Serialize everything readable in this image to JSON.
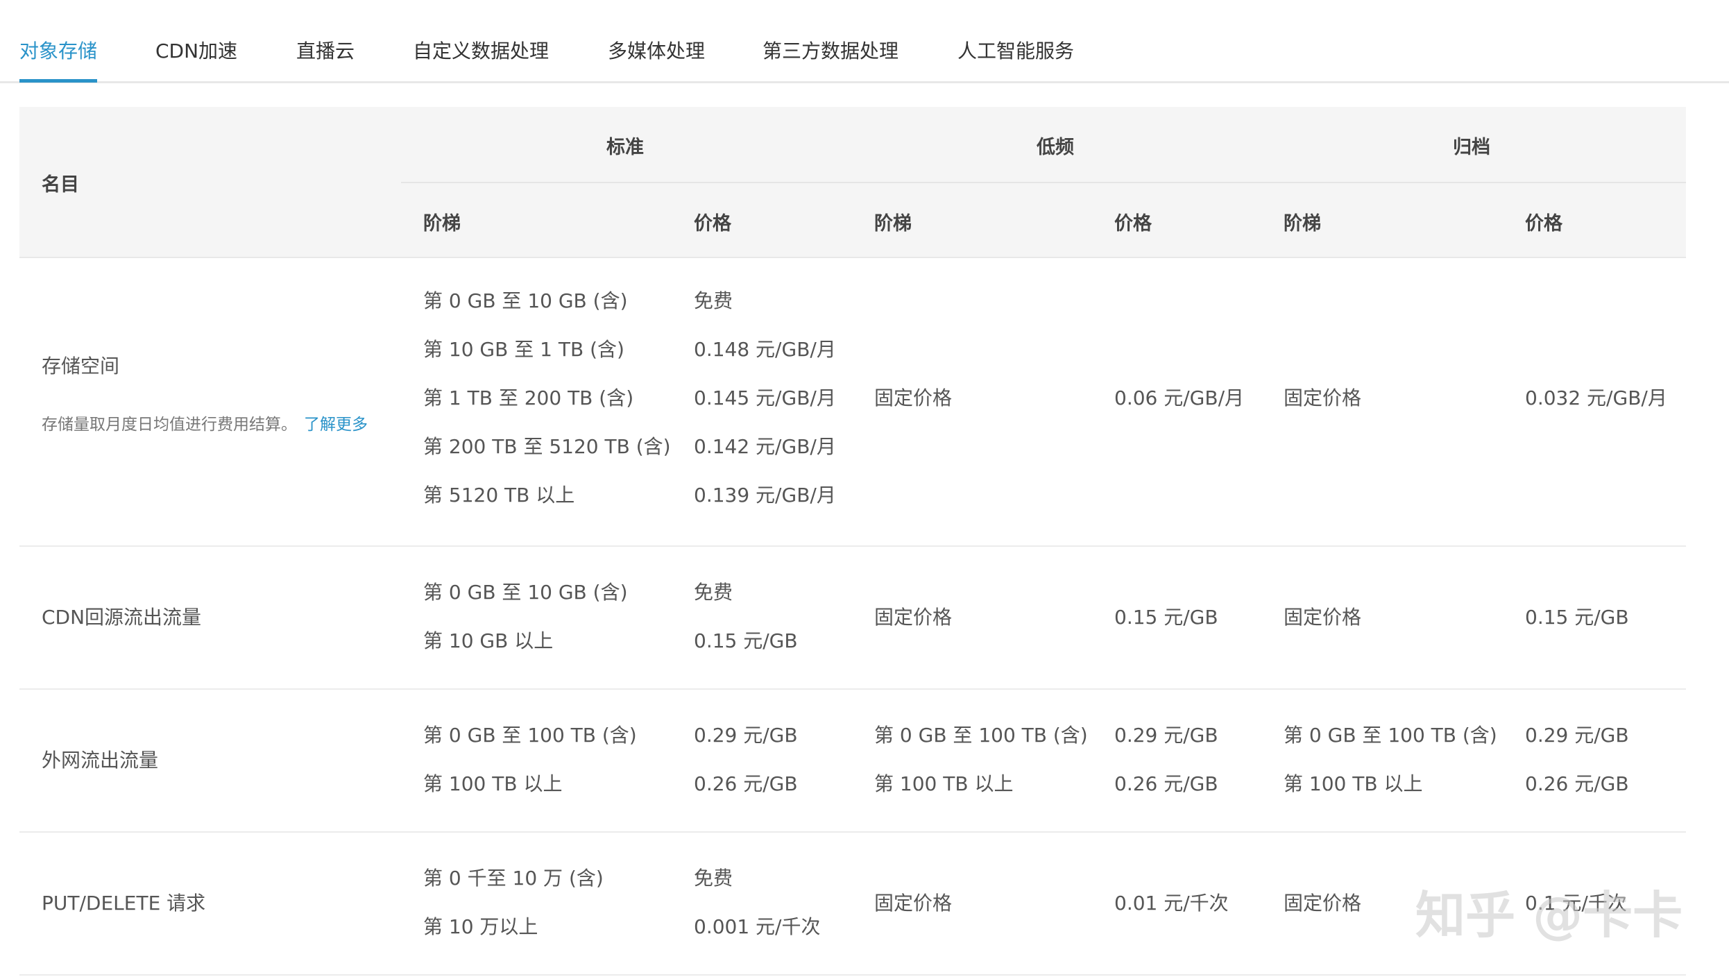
{
  "tabs": [
    {
      "label": "对象存储",
      "active": true
    },
    {
      "label": "CDN加速",
      "active": false
    },
    {
      "label": "直播云",
      "active": false
    },
    {
      "label": "自定义数据处理",
      "active": false
    },
    {
      "label": "多媒体处理",
      "active": false
    },
    {
      "label": "第三方数据处理",
      "active": false
    },
    {
      "label": "人工智能服务",
      "active": false
    }
  ],
  "table": {
    "headers": {
      "name": "名目",
      "groups": [
        "标准",
        "低频",
        "归档"
      ],
      "tier": "阶梯",
      "price": "价格"
    },
    "rows": {
      "storage": {
        "name": "存储空间",
        "note": "存储量取月度日均值进行费用结算。",
        "link": "了解更多",
        "standard_tiers": [
          "第 0 GB 至 10 GB (含)",
          "第 10 GB 至 1 TB (含)",
          "第 1 TB 至 200 TB (含)",
          "第 200 TB 至 5120 TB (含)",
          "第 5120 TB 以上"
        ],
        "standard_prices": [
          "免费",
          "0.148 元/GB/月",
          "0.145 元/GB/月",
          "0.142 元/GB/月",
          "0.139 元/GB/月"
        ],
        "lowfreq_tier": "固定价格",
        "lowfreq_price": "0.06 元/GB/月",
        "archive_tier": "固定价格",
        "archive_price": "0.032 元/GB/月"
      },
      "cdn": {
        "name": "CDN回源流出流量",
        "standard_tiers": [
          "第 0 GB 至 10 GB (含)",
          "第 10 GB 以上"
        ],
        "standard_prices": [
          "免费",
          "0.15 元/GB"
        ],
        "lowfreq_tier": "固定价格",
        "lowfreq_price": "0.15 元/GB",
        "archive_tier": "固定价格",
        "archive_price": "0.15 元/GB"
      },
      "outbound": {
        "name": "外网流出流量",
        "standard_tiers": [
          "第 0 GB 至 100 TB (含)",
          "第 100 TB 以上"
        ],
        "standard_prices": [
          "0.29 元/GB",
          "0.26 元/GB"
        ],
        "lowfreq_tiers": [
          "第 0 GB 至 100 TB (含)",
          "第 100 TB 以上"
        ],
        "lowfreq_prices": [
          "0.29 元/GB",
          "0.26 元/GB"
        ],
        "archive_tiers": [
          "第 0 GB 至 100 TB (含)",
          "第 100 TB 以上"
        ],
        "archive_prices": [
          "0.29 元/GB",
          "0.26 元/GB"
        ]
      },
      "put": {
        "name": "PUT/DELETE 请求",
        "standard_tiers": [
          "第 0 千至 10 万 (含)",
          "第 10 万以上"
        ],
        "standard_prices": [
          "免费",
          "0.001 元/千次"
        ],
        "lowfreq_tier": "固定价格",
        "lowfreq_price": "0.01 元/千次",
        "archive_tier": "固定价格",
        "archive_price": "0.1 元/千次"
      }
    }
  },
  "watermark": "知乎 @卡卡",
  "colors": {
    "accent": "#2a93c9",
    "header_bg": "#f5f5f5"
  }
}
